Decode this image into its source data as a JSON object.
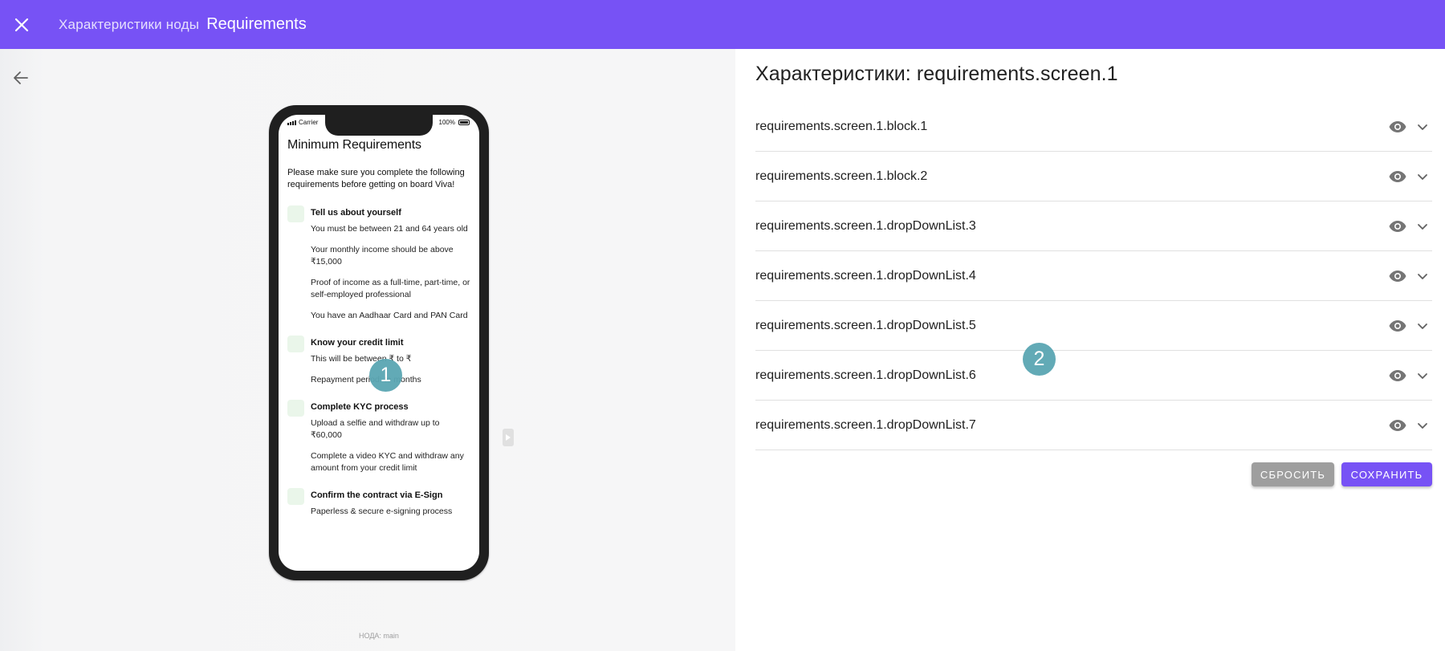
{
  "appbar": {
    "breadcrumb": "Характеристики ноды",
    "title": "Requirements",
    "close_icon": "close-icon"
  },
  "preview": {
    "back_icon": "arrow-left-icon",
    "phone": {
      "carrier": "Carrier",
      "battery": "100%",
      "title": "Minimum Requirements",
      "intro": "Please make sure you complete the following requirements before getting on board Viva!",
      "sections": [
        {
          "heading": "Tell us about yourself",
          "items": [
            "You must be between 21 and 64 years old",
            "Your monthly income should be above ₹15,000",
            "Proof of income as a full-time, part-time, or self-employed professional",
            "You have an Aadhaar Card and PAN Card"
          ]
        },
        {
          "heading": "Know your credit limit",
          "items": [
            "This will be between ₹ to ₹",
            "Repayment period: to months"
          ]
        },
        {
          "heading": "Complete KYC process",
          "items": [
            "Upload a selfie and withdraw up to ₹60,000",
            "Complete a video KYC and withdraw any amount from your credit limit"
          ]
        },
        {
          "heading": "Confirm the contract via E-Sign",
          "items": [
            "Paperless & secure e-signing process"
          ]
        }
      ]
    },
    "node_label": "НОДА: main",
    "badge": "1"
  },
  "panel": {
    "title": "Характеристики: requirements.screen.1",
    "items": [
      "requirements.screen.1.block.1",
      "requirements.screen.1.block.2",
      "requirements.screen.1.dropDownList.3",
      "requirements.screen.1.dropDownList.4",
      "requirements.screen.1.dropDownList.5",
      "requirements.screen.1.dropDownList.6",
      "requirements.screen.1.dropDownList.7"
    ],
    "badge": "2",
    "reset_label": "СБРОСИТЬ",
    "save_label": "СОХРАНИТЬ"
  },
  "colors": {
    "brand": "#7752f5",
    "badge": "#5aa6b3",
    "reset": "#9e9e9e"
  }
}
